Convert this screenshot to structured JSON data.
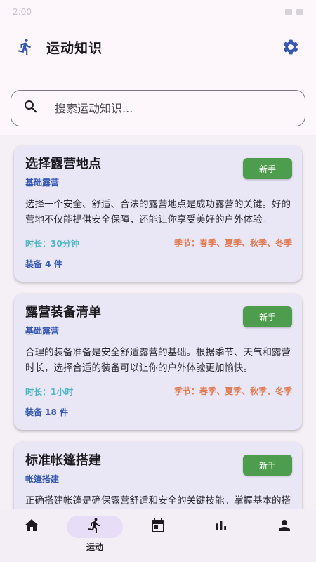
{
  "status_bar": {
    "time": "2:00"
  },
  "header": {
    "title": "运动知识"
  },
  "search": {
    "placeholder": "搜索运动知识..."
  },
  "cards": [
    {
      "title": "选择露营地点",
      "category": "基础露营",
      "level": "新手",
      "description": "选择一个安全、舒适、合法的露营地点是成功露营的关键。好的营地不仅能提供安全保障，还能让你享受美好的户外体验。",
      "duration": "时长：30分钟",
      "seasons": "季节：春季、夏季、秋季、冬季",
      "gear": "装备 4 件"
    },
    {
      "title": "露营装备清单",
      "category": "基础露营",
      "level": "新手",
      "description": "合理的装备准备是安全舒适露营的基础。根据季节、天气和露营时长，选择合适的装备可以让你的户外体验更加愉快。",
      "duration": "时长：1小时",
      "seasons": "季节：春季、夏季、秋季、冬季",
      "gear": "装备 18 件"
    },
    {
      "title": "标准帐篷搭建",
      "category": "帐篷搭建",
      "level": "新手",
      "description": "正确搭建帐篷是确保露营舒适和安全的关键技能。掌握基本的搭建步骤可以让你在任何天气条件下都能快速搭好帐篷。",
      "duration": "",
      "seasons": "",
      "gear": ""
    }
  ],
  "bottom_nav": {
    "active_label": "运动",
    "items": [
      "home-icon",
      "run-icon",
      "calendar-icon",
      "bar-chart-icon",
      "person-icon"
    ]
  },
  "colors": {
    "accent": "#3558b4",
    "level_green": "#4e9c4e",
    "duration": "#4fb6c6",
    "season": "#e07a52"
  }
}
